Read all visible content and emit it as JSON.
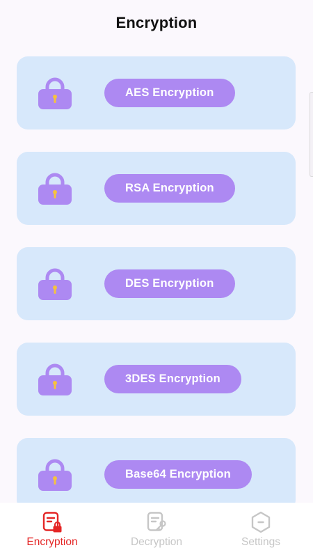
{
  "header": {
    "title": "Encryption"
  },
  "colors": {
    "card_bg": "#d7e8fb",
    "button_bg": "#ad89f2",
    "lock_color": "#ad89f2",
    "keyhole_color": "#f6c23e",
    "active_tab": "#e42525",
    "inactive_tab": "#c6c6c6"
  },
  "cards": [
    {
      "icon": "lock-icon",
      "label": "AES Encryption"
    },
    {
      "icon": "lock-icon",
      "label": "RSA Encryption"
    },
    {
      "icon": "lock-icon",
      "label": "DES Encryption"
    },
    {
      "icon": "lock-icon",
      "label": "3DES Encryption"
    },
    {
      "icon": "lock-icon",
      "label": "Base64 Encryption"
    }
  ],
  "bottom_nav": {
    "items": [
      {
        "label": "Encryption",
        "icon": "encryption-tab-icon",
        "active": true
      },
      {
        "label": "Decryption",
        "icon": "decryption-tab-icon",
        "active": false
      },
      {
        "label": "Settings",
        "icon": "settings-tab-icon",
        "active": false
      }
    ]
  }
}
